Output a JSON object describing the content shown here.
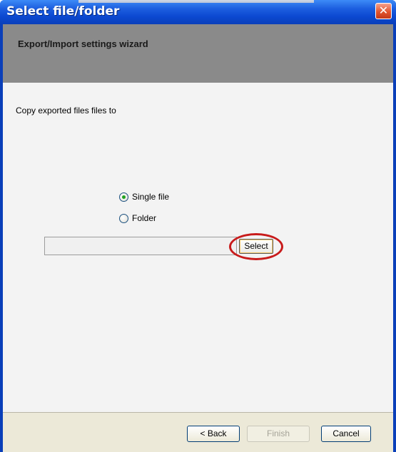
{
  "window": {
    "title": "Select file/folder",
    "close_glyph": "✕"
  },
  "header": {
    "title": "Export/Import settings wizard"
  },
  "content": {
    "instruction": "Copy exported files files to",
    "options": [
      {
        "label": "Single file",
        "selected": true
      },
      {
        "label": "Folder",
        "selected": false
      }
    ],
    "path_value": "",
    "select_label": "Select"
  },
  "footer": {
    "back_label": "< Back",
    "finish_label": "Finish",
    "cancel_label": "Cancel"
  },
  "colors": {
    "titlebar": "#0a3fb9",
    "header_band": "#8a8a8a",
    "highlight": "#c81b1b"
  }
}
